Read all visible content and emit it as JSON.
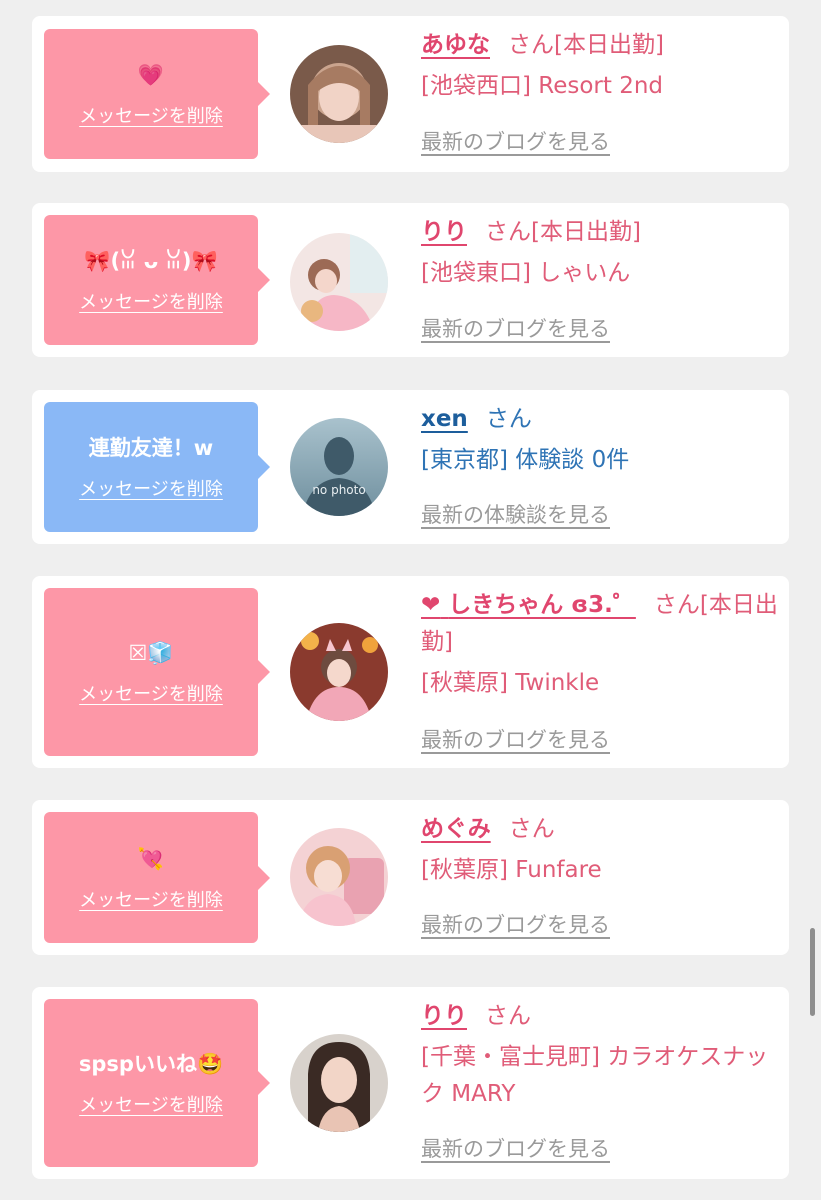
{
  "delete_label": "メッセージを削除",
  "san_label": "さん",
  "cards": [
    {
      "message": "💗",
      "name": "あゆな",
      "status": "[本日出勤]",
      "area": "[池袋西口]",
      "shop": "Resort 2nd",
      "link": "最新のブログを見る",
      "bubble_color": "#fd97a7"
    },
    {
      "message": "🎀(ꈍ ᴗ ꈍ)🎀",
      "name": "りり",
      "status": "[本日出勤]",
      "area": "[池袋東口]",
      "shop": "しゃいん",
      "link": "最新のブログを見る",
      "bubble_color": "#fd97a7"
    },
    {
      "message": "連勤友達！w",
      "name": "xen",
      "status": "",
      "area": "[東京都]",
      "shop": "体験談 0件",
      "link": "最新の体験談を見る",
      "avatar_text": "no photo",
      "bubble_color": "#8ab8f6"
    },
    {
      "message": "☒🧊",
      "name": "しきちゃん ɞ3.゜",
      "name_prefix": "❤",
      "status": "[本日出勤]",
      "area": "[秋葉原]",
      "shop": "Twinkle",
      "link": "最新のブログを見る",
      "bubble_color": "#fd97a7"
    },
    {
      "message": "💘",
      "name": "めぐみ",
      "status": "",
      "area": "[秋葉原]",
      "shop": "Funfare",
      "link": "最新のブログを見る",
      "bubble_color": "#fd97a7"
    },
    {
      "message": "spspいいね🤩",
      "name": "りり",
      "status": "",
      "area": "[千葉・富士見町]",
      "shop": "カラオケスナック MARY",
      "link": "最新のブログを見る",
      "bubble_color": "#fd97a7"
    }
  ]
}
